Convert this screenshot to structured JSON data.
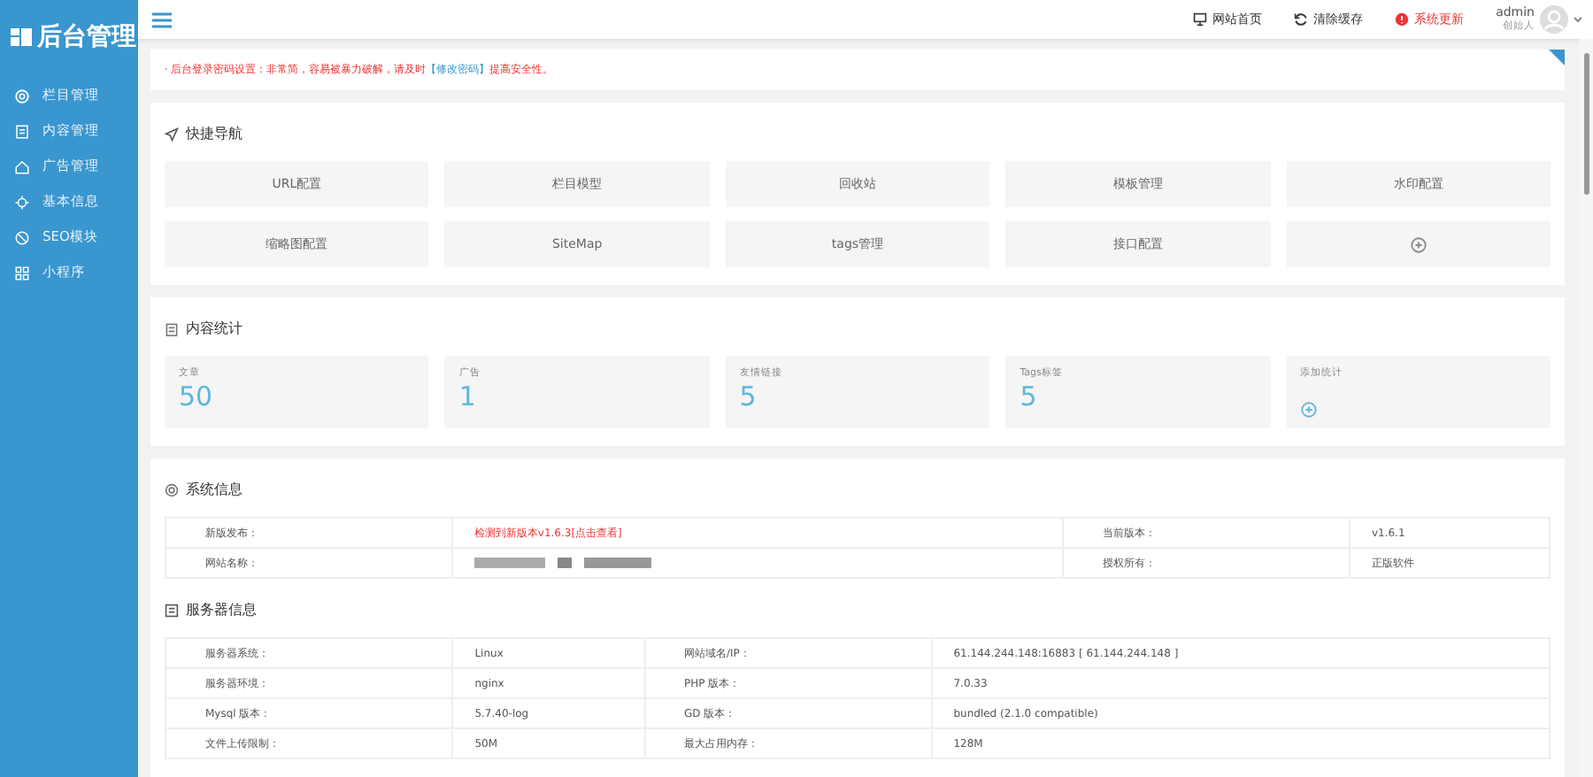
{
  "sidebar": {
    "logo": "后台管理",
    "items": [
      {
        "label": "栏目管理",
        "selected": false
      },
      {
        "label": "内容管理",
        "selected": false
      },
      {
        "label": "广告管理",
        "selected": false
      },
      {
        "label": "基本信息",
        "selected": false
      },
      {
        "label": "SEO模块",
        "selected": false
      },
      {
        "label": "小程序",
        "selected": false
      }
    ]
  },
  "header": {
    "links": [
      {
        "label": "网站首页",
        "kind": "monitor"
      },
      {
        "label": "清除缓存",
        "kind": "refresh"
      },
      {
        "label": "系统更新",
        "kind": "alert"
      }
    ],
    "user": {
      "name": "admin",
      "role": "创始人"
    }
  },
  "notice": {
    "text": "· 后台登录密码设置：非常简，容易被暴力破解，请及时",
    "link": "【修改密码】",
    "after": "提高安全性。"
  },
  "quick_nav": {
    "title": "快捷导航",
    "items": [
      {
        "label": "URL配置"
      },
      {
        "label": "栏目模型"
      },
      {
        "label": "回收站"
      },
      {
        "label": "模板管理"
      },
      {
        "label": "水印配置"
      },
      {
        "label": "缩略图配置"
      },
      {
        "label": "SiteMap"
      },
      {
        "label": "tags管理"
      },
      {
        "label": "接口配置"
      },
      {
        "kind": "add"
      }
    ]
  },
  "stats": {
    "title": "内容统计",
    "items": [
      {
        "label": "文章",
        "value": "50"
      },
      {
        "label": "广告",
        "value": "1"
      },
      {
        "label": "友情链接",
        "value": "5"
      },
      {
        "label": "Tags标签",
        "value": "5"
      },
      {
        "label": "添加统计",
        "kind": "add"
      }
    ]
  },
  "system": {
    "title": "系统信息",
    "rows": [
      [
        {
          "label": "新版发布：",
          "value": "检测到新版本v1.6.3[点击查看]",
          "kind": "alert"
        },
        {
          "label": "当前版本：",
          "value": "v1.6.1"
        }
      ],
      [
        {
          "label": "网站名称：",
          "kind": "blurred"
        },
        {
          "label": "授权所有：",
          "value": "正版软件"
        }
      ]
    ]
  },
  "server": {
    "title": "服务器信息",
    "rows": [
      [
        {
          "label": "服务器系统：",
          "value": "Linux"
        },
        {
          "label": "网站域名/IP：",
          "value": "61.144.244.148:16883 [ 61.144.244.148 ]"
        }
      ],
      [
        {
          "label": "服务器环境：",
          "value": "nginx"
        },
        {
          "label": "PHP 版本：",
          "value": "7.0.33"
        }
      ],
      [
        {
          "label": "Mysql 版本：",
          "value": "5.7.40-log"
        },
        {
          "label": "GD 版本：",
          "value": "bundled (2.1.0 compatible)"
        }
      ],
      [
        {
          "label": "文件上传限制：",
          "value": "50M"
        },
        {
          "label": "最大占用内存：",
          "value": "128M"
        }
      ]
    ]
  }
}
